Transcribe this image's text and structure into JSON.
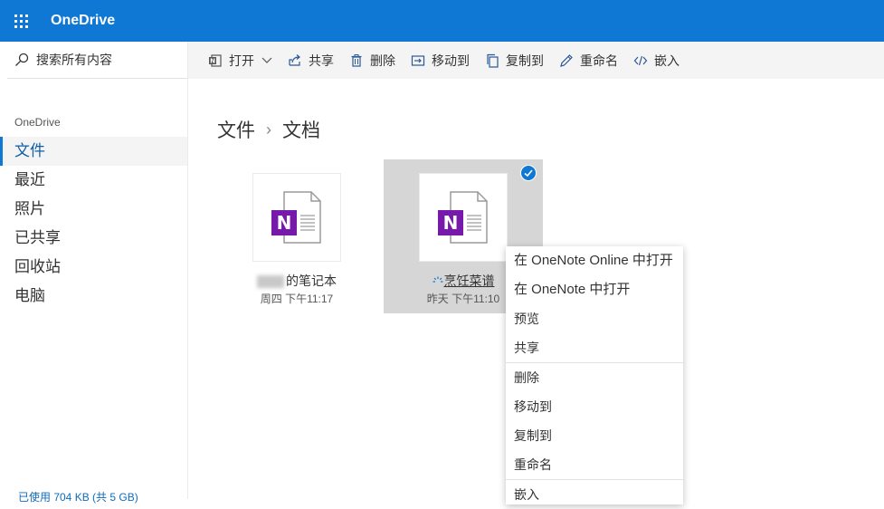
{
  "app": {
    "title": "OneDrive"
  },
  "search": {
    "placeholder": "搜索所有内容"
  },
  "sidebar": {
    "section": "OneDrive",
    "items": [
      {
        "label": "文件"
      },
      {
        "label": "最近"
      },
      {
        "label": "照片"
      },
      {
        "label": "已共享"
      },
      {
        "label": "回收站"
      },
      {
        "label": "电脑"
      }
    ],
    "storage": "已使用 704 KB (共 5 GB)"
  },
  "toolbar": {
    "open": "打开",
    "share": "共享",
    "delete": "删除",
    "move": "移动到",
    "copy": "复制到",
    "rename": "重命名",
    "embed": "嵌入"
  },
  "breadcrumb": {
    "root": "文件",
    "current": "文档"
  },
  "files": [
    {
      "name_suffix": "的笔记本",
      "date": "周四 下午11:17"
    },
    {
      "name": "烹饪菜谱",
      "date": "昨天 下午11:10"
    }
  ],
  "context_menu": {
    "group1": [
      "在 OneNote Online 中打开",
      "在 OneNote 中打开",
      "预览",
      "共享"
    ],
    "group2": [
      "删除",
      "移动到",
      "复制到",
      "重命名"
    ],
    "group3": [
      "嵌入"
    ]
  },
  "colors": {
    "brand": "#0f78d4",
    "onenote": "#7719aa"
  }
}
